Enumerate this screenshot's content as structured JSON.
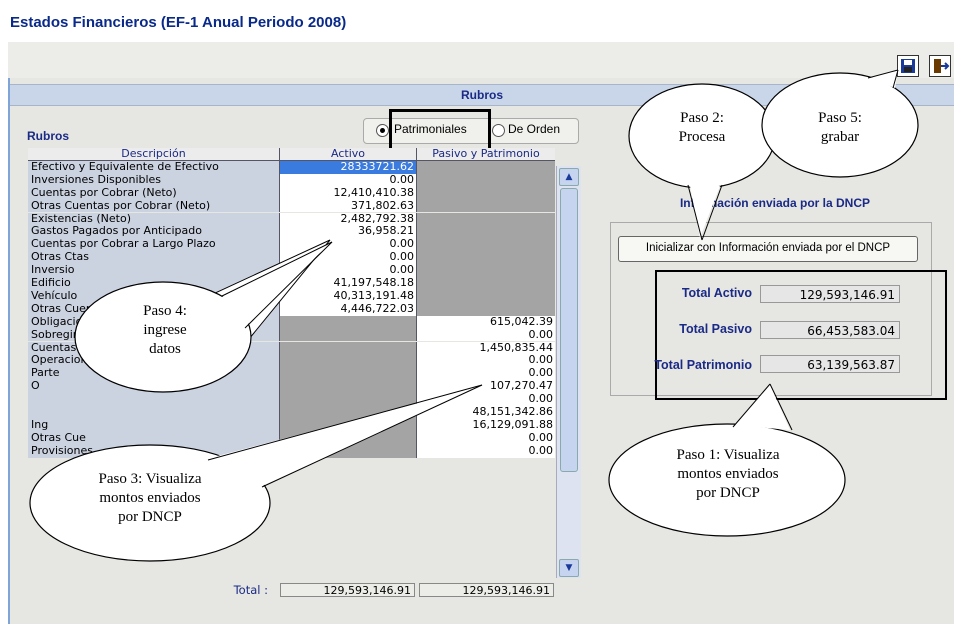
{
  "window": {
    "title": "Estados Financieros (EF-1 Anual Periodo 2008)"
  },
  "toolbar": {
    "save_icon": "save-icon",
    "exit_icon": "exit-icon"
  },
  "section": {
    "header": "Rubros",
    "label": "Rubros"
  },
  "radios": {
    "selected": "Patrimoniales",
    "options": [
      "Patrimoniales",
      "De Orden"
    ]
  },
  "table": {
    "columns": [
      "Descripción",
      "Activo",
      "Pasivo y Patrimonio"
    ],
    "rows": [
      {
        "desc": "Efectivo y Equivalente de Efectivo",
        "activo": "28333721.62",
        "pasivo": ""
      },
      {
        "desc": "Inversiones Disponibles",
        "activo": "0.00",
        "pasivo": ""
      },
      {
        "desc": "Cuentas por Cobrar (Neto)",
        "activo": "12,410,410.38",
        "pasivo": ""
      },
      {
        "desc": "Otras Cuentas por Cobrar (Neto)",
        "activo": "371,802.63",
        "pasivo": ""
      },
      {
        "desc": "Existencias (Neto)",
        "activo": "2,482,792.38",
        "pasivo": ""
      },
      {
        "desc": "Gastos Pagados por Anticipado",
        "activo": "36,958.21",
        "pasivo": ""
      },
      {
        "desc": "Cuentas por Cobrar a Largo Plazo",
        "activo": "0.00",
        "pasivo": ""
      },
      {
        "desc": "Otras Ctas",
        "activo": "0.00",
        "pasivo": ""
      },
      {
        "desc": "Inversio",
        "activo": "0.00",
        "pasivo": ""
      },
      {
        "desc": "Edificio",
        "activo": "41,197,548.18",
        "pasivo": ""
      },
      {
        "desc": "Vehículo",
        "activo": "40,313,191.48",
        "pasivo": ""
      },
      {
        "desc": "Otras Cuen",
        "activo": "4,446,722.03",
        "pasivo": ""
      },
      {
        "desc": "Obligaciones Tesoro Público",
        "activo": "",
        "pasivo": "615,042.39"
      },
      {
        "desc": "Sobregiros Bancarios",
        "activo": "",
        "pasivo": "0.00"
      },
      {
        "desc": "Cuentas por Pagar",
        "activo": "",
        "pasivo": "1,450,835.44"
      },
      {
        "desc": "Operaciones de Crédito",
        "activo": "",
        "pasivo": "0.00"
      },
      {
        "desc": "Parte",
        "activo": "",
        "pasivo": "0.00"
      },
      {
        "desc": "O",
        "activo": "",
        "pasivo": "107,270.47"
      },
      {
        "desc": "",
        "activo": "",
        "pasivo": "0.00"
      },
      {
        "desc": "",
        "activo": "",
        "pasivo": "48,151,342.86"
      },
      {
        "desc": "Ing",
        "activo": "",
        "pasivo": "16,129,091.88"
      },
      {
        "desc": "Otras Cue",
        "activo": "",
        "pasivo": "0.00"
      },
      {
        "desc": "Provisiones",
        "activo": "",
        "pasivo": "0.00"
      }
    ],
    "total_label": "Total :",
    "total_activo": "129,593,146.91",
    "total_pasivo": "129,593,146.91"
  },
  "info": {
    "title": "Información enviada por la DNCP",
    "button": "Inicializar con Información enviada por el DNCP",
    "totals": [
      {
        "label": "Total Activo",
        "value": "129,593,146.91"
      },
      {
        "label": "Total Pasivo",
        "value": "66,453,583.04"
      },
      {
        "label": "Total Patrimonio",
        "value": "63,139,563.87"
      }
    ]
  },
  "callouts": {
    "paso1": [
      "Paso 1: Visualiza",
      "montos enviados",
      "por DNCP"
    ],
    "paso2": [
      "Paso 2:",
      "Procesa"
    ],
    "paso3": [
      "Paso 3: Visualiza",
      "montos enviados",
      "por DNCP"
    ],
    "paso4": [
      "Paso 4:",
      "ingrese",
      "datos"
    ],
    "paso5": [
      "Paso 5:",
      "grabar"
    ]
  }
}
